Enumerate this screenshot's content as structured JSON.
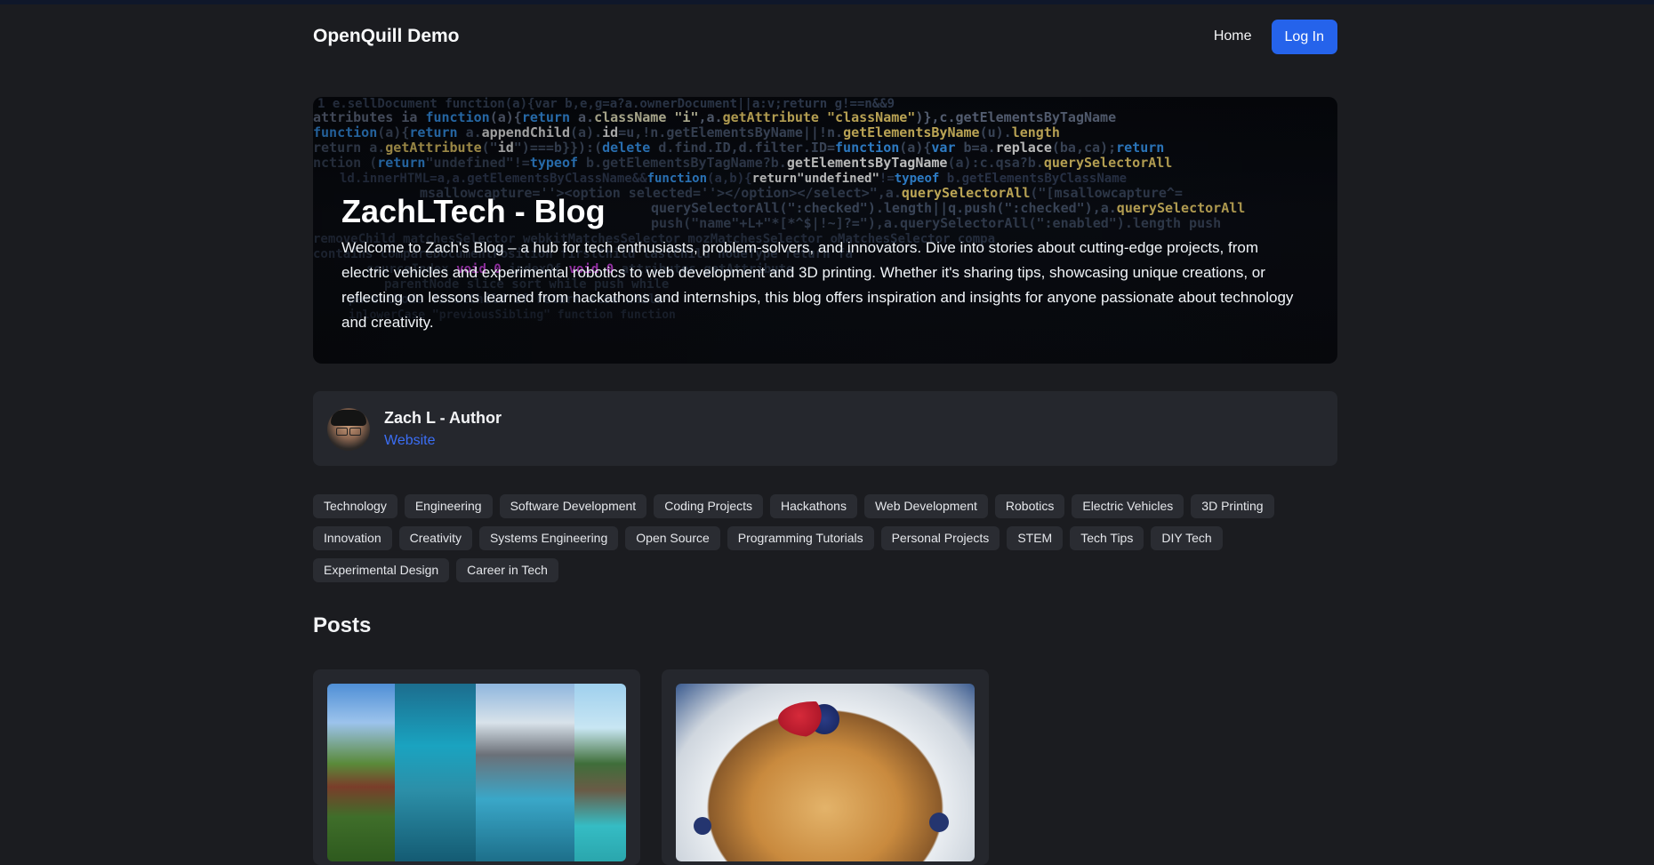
{
  "nav": {
    "brand": "OpenQuill Demo",
    "home_label": "Home",
    "login_label": "Log In"
  },
  "hero": {
    "title": "ZachLTech - Blog",
    "description": "Welcome to Zach's Blog – a hub for tech enthusiasts, problem-solvers, and innovators. Dive into stories about cutting-edge projects, from electric vehicles and experimental robotics to web development and 3D printing. Whether it's sharing tips, showcasing unique creations, or reflecting on lessons learned from hackathons and internships, this blog offers inspiration and insights for anyone passionate about technology and creativity."
  },
  "author": {
    "name": "Zach L - Author",
    "link_label": "Website"
  },
  "tags": [
    "Technology",
    "Engineering",
    "Software Development",
    "Coding Projects",
    "Hackathons",
    "Web Development",
    "Robotics",
    "Electric Vehicles",
    "3D Printing",
    "Innovation",
    "Creativity",
    "Systems Engineering",
    "Open Source",
    "Programming Tutorials",
    "Personal Projects",
    "STEM",
    "Tech Tips",
    "DIY Tech",
    "Experimental Design",
    "Career in Tech"
  ],
  "posts": {
    "heading": "Posts"
  },
  "colors": {
    "background": "#1b1c20",
    "card": "#25272d",
    "accent": "#2563eb",
    "link": "#3b6ef5"
  }
}
